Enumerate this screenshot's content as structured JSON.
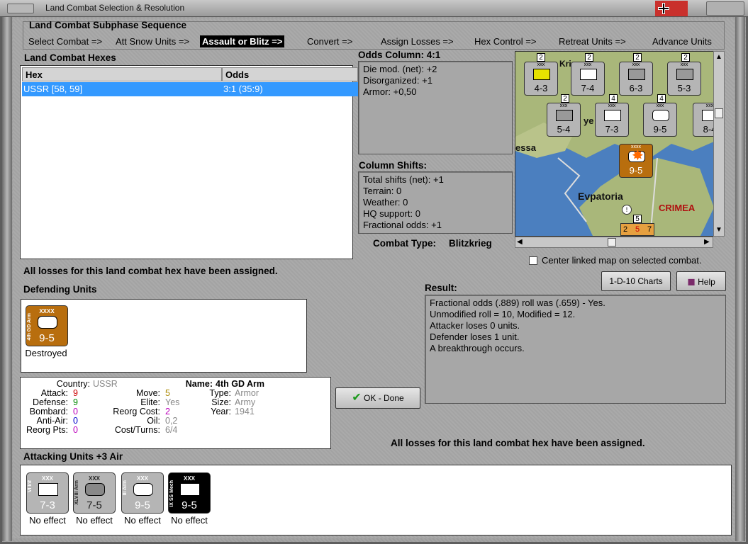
{
  "window": {
    "title": "Land Combat Selection & Resolution"
  },
  "subphase": {
    "title": "Land Combat Subphase Sequence",
    "steps": [
      "Select Combat =>",
      "Att Snow Units =>",
      "Assault or Blitz =>",
      "Convert =>",
      "Assign Losses =>",
      "Hex Control =>",
      "Retreat Units =>",
      "Advance Units"
    ]
  },
  "hexes": {
    "title": "Land Combat Hexes",
    "columns": [
      "Hex",
      "Odds"
    ],
    "rows": [
      {
        "hex": "USSR [58, 59]",
        "odds": "3:1 (35:9)"
      }
    ]
  },
  "odds": {
    "title": "Odds Column: 4:1",
    "lines": [
      "Die mod. (net): +2",
      "Disorganized: +1",
      "Armor: +0,50"
    ]
  },
  "shifts": {
    "title": "Column Shifts:",
    "lines": [
      "Total shifts (net): +1",
      "Terrain: 0",
      "Weather: 0",
      "HQ support: 0",
      "Fractional odds: +1"
    ]
  },
  "combat_type": {
    "label": "Combat Type:",
    "value": "Blitzkrieg"
  },
  "map": {
    "places": [
      "Evpatoria",
      "CRIMEA",
      "essa",
      "Kri",
      "ye"
    ],
    "counters": [
      {
        "value": "4-3",
        "size": "xxx"
      },
      {
        "value": "7-4",
        "size": "xxx"
      },
      {
        "value": "6-3",
        "size": "xxx"
      },
      {
        "value": "5-3",
        "size": "xxx"
      },
      {
        "value": "5-4",
        "size": "xxx"
      },
      {
        "value": "7-3",
        "size": "xxx"
      },
      {
        "value": "9-5",
        "size": "xxx"
      },
      {
        "value": "8-4",
        "size": "xxx"
      },
      {
        "value": "9-5",
        "size": "xxxx"
      }
    ],
    "stack_badges": [
      "2",
      "2",
      "2",
      "2",
      "2",
      "4",
      "4",
      "5"
    ],
    "bottom_stack": [
      "2",
      "5",
      "7"
    ]
  },
  "center_map": {
    "label": "Center linked map on selected combat."
  },
  "buttons": {
    "charts": "1-D-10 Charts",
    "help": "Help",
    "ok": "OK - Done"
  },
  "losses_msg": "All losses for this land combat hex have been assigned.",
  "defending": {
    "title": "Defending Units",
    "units": [
      {
        "name": "4th GD Arm",
        "size": "XXXX",
        "value": "9-5",
        "status": "Destroyed"
      }
    ]
  },
  "result": {
    "title": "Result:",
    "lines": [
      "Fractional odds (.889) roll was (.659)  - Yes.",
      "Unmodified roll = 10, Modified = 12.",
      "Attacker loses 0 units.",
      "Defender loses 1 unit.",
      "A breakthrough occurs."
    ]
  },
  "unit_info": {
    "country_label": "Country:",
    "country": "USSR",
    "attack_label": "Attack:",
    "attack": "9",
    "defense_label": "Defense:",
    "defense": "9",
    "bombard_label": "Bombard:",
    "bombard": "0",
    "antiair_label": "Anti-Air:",
    "antiair": "0",
    "reorgpts_label": "Reorg Pts:",
    "reorgpts": "0",
    "move_label": "Move:",
    "move": "5",
    "elite_label": "Elite:",
    "elite": "Yes",
    "reorgcost_label": "Reorg Cost:",
    "reorgcost": "2",
    "oil_label": "Oil:",
    "oil": "0,2",
    "costturns_label": "Cost/Turns:",
    "costturns": "6/4",
    "name_label": "Name:",
    "name": "4th GD Arm",
    "type_label": "Type:",
    "type": "Armor",
    "size_label": "Size:",
    "size": "Army",
    "year_label": "Year:",
    "year": "1941"
  },
  "attacking": {
    "title": "Attacking Units +3 Air",
    "units": [
      {
        "name": "VI Inf",
        "size": "XXX",
        "value": "7-3",
        "status": "No effect"
      },
      {
        "name": "XLVIII Arm",
        "size": "XXX",
        "value": "7-5",
        "status": "No effect"
      },
      {
        "name": "III Arm",
        "size": "XXX",
        "value": "9-5",
        "status": "No effect"
      },
      {
        "name": "IX SS Mech",
        "size": "XXX",
        "value": "9-5",
        "status": "No effect"
      }
    ]
  },
  "colors": {
    "accent": "#3399ff",
    "german": "#b5b5b5",
    "soviet": "#b86e0e",
    "ss": "#000000"
  }
}
